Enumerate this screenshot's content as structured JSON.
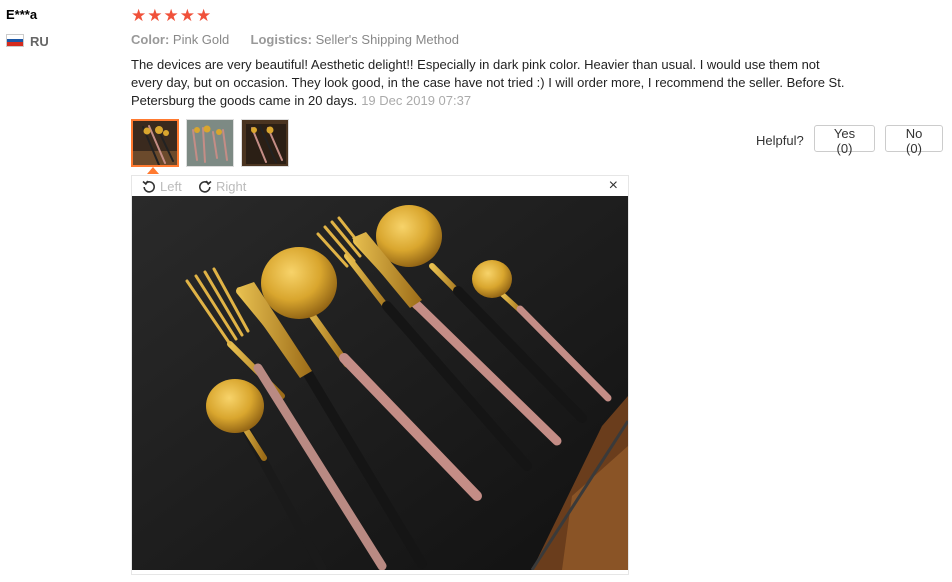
{
  "reviewer": {
    "name": "E***a",
    "country_code": "RU"
  },
  "rating": {
    "stars": "★★★★★",
    "value": 5
  },
  "attributes": {
    "color_label": "Color:",
    "color_value": "Pink Gold",
    "logistics_label": "Logistics:",
    "logistics_value": "Seller's Shipping Method"
  },
  "review": {
    "text": "The devices are very beautiful! Aesthetic delight!! Especially in dark pink color. Heavier than usual. I would use them not every day, but on occasion. They look good, in the case have not tried :) I will order more, I recommend the seller. Before St. Petersburg the goods came in 20 days.",
    "date": "19 Dec 2019 07:37"
  },
  "helpful": {
    "label": "Helpful?",
    "yes": "Yes (0)",
    "no": "No (0)"
  },
  "viewer": {
    "rotate_left": "Left",
    "rotate_right": "Right",
    "close": "×"
  },
  "colors": {
    "star": "#f0513a",
    "accent": "#ff7a30",
    "gold": "#d9a62e",
    "pink": "#c48d86",
    "table": "#1b1b1b"
  }
}
